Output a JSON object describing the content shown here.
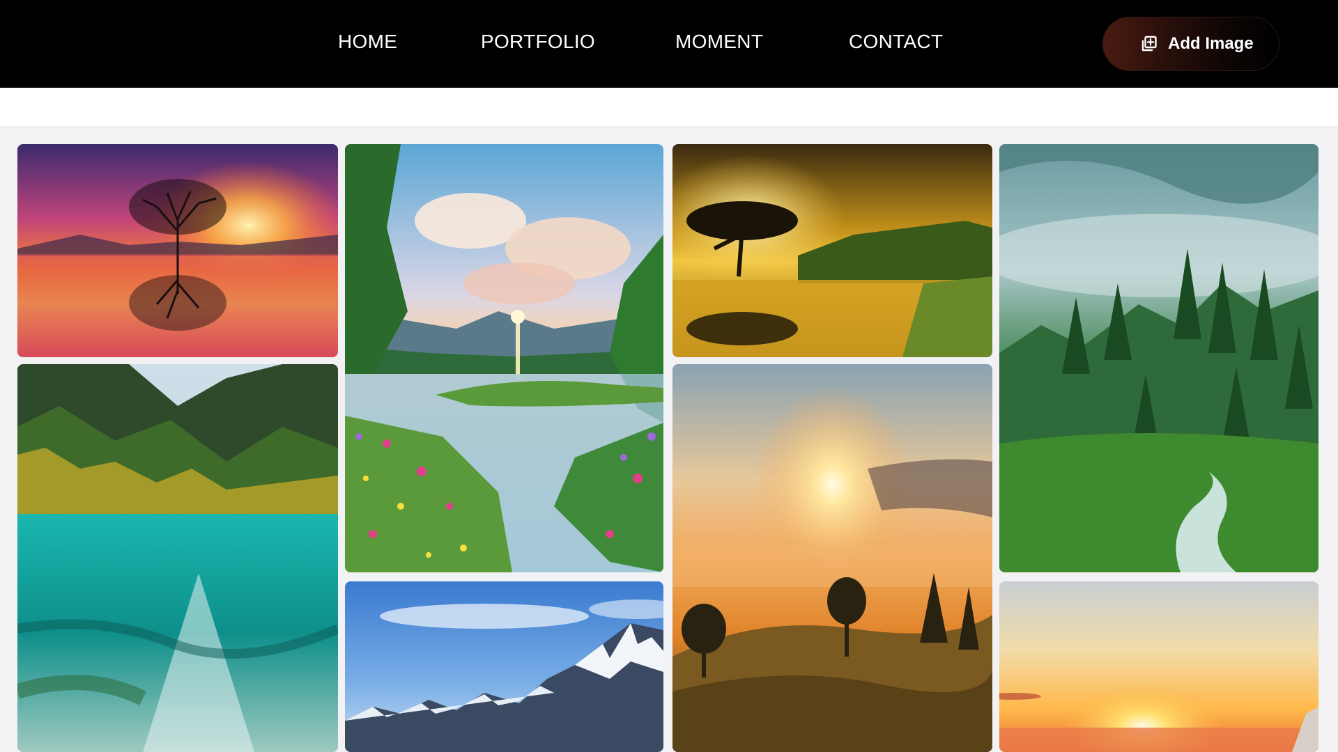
{
  "nav": {
    "links": [
      {
        "label": "HOME"
      },
      {
        "label": "PORTFOLIO"
      },
      {
        "label": "MOMENT"
      },
      {
        "label": "CONTACT"
      }
    ],
    "add_button": {
      "label": "Add Image",
      "icon": "add-image-icon"
    }
  },
  "gallery": {
    "images": [
      {
        "subject": "sunset tree reflected in lake"
      },
      {
        "subject": "river with wildflowers at sunrise"
      },
      {
        "subject": "acacia tree reflected in pond at sunset"
      },
      {
        "subject": "misty green forest mountains with stream"
      },
      {
        "subject": "turquoise mountain lake with autumn trees"
      },
      {
        "subject": "sun over misty hills with trees"
      },
      {
        "subject": "snowy mountain range under blue sky"
      },
      {
        "subject": "sunset over ocean"
      }
    ]
  },
  "colors": {
    "nav_background": "#000000",
    "page_background": "#f2f2f5",
    "button_gradient_start": "#4a1b12"
  }
}
